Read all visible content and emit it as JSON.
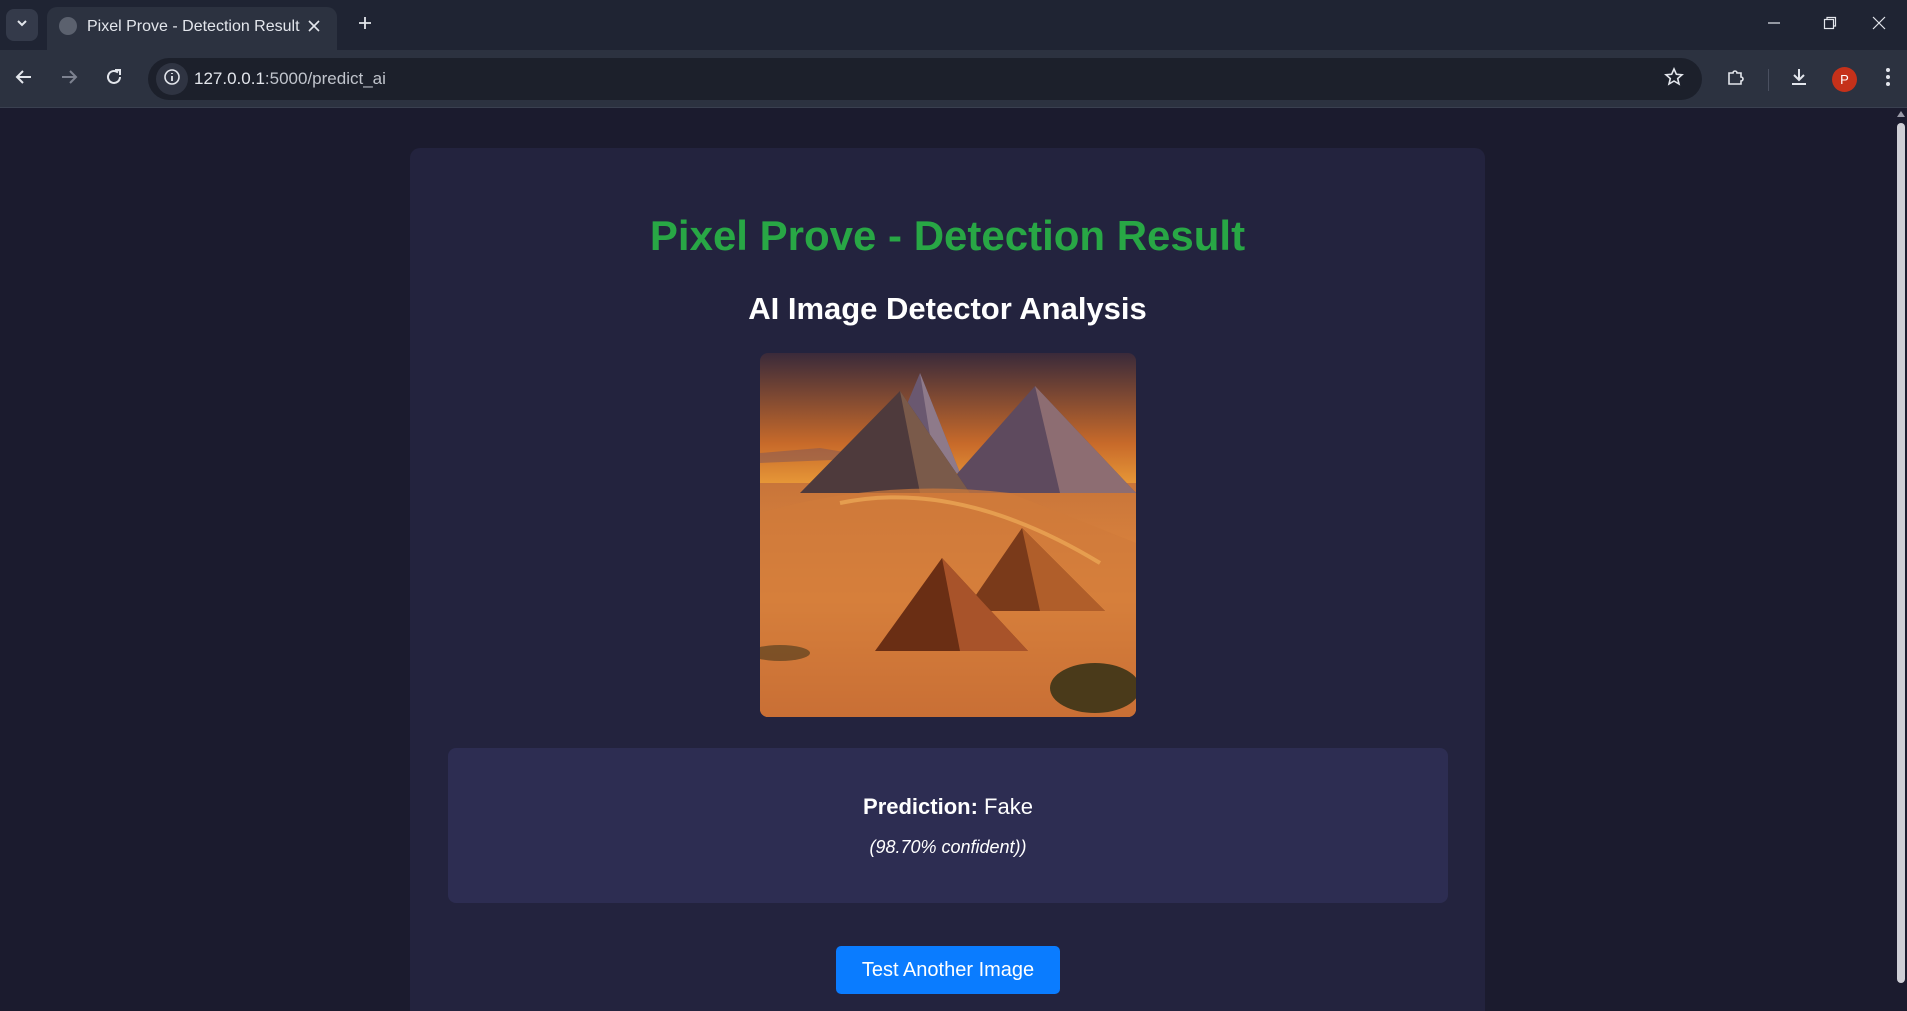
{
  "browser": {
    "tab_title": "Pixel Prove - Detection Result",
    "url_host": "127.0.0.1",
    "url_path": ":5000/predict_ai",
    "profile_initial": "P"
  },
  "page": {
    "title": "Pixel Prove - Detection Result",
    "subtitle": "AI Image Detector Analysis",
    "image_alt": "Pyramids in desert at sunset",
    "prediction_label": "Prediction:",
    "prediction_value": "Fake",
    "confidence_text": "(98.70% confident))",
    "button_label": "Test Another Image"
  },
  "colors": {
    "title": "#28a745",
    "button": "#0a7cff",
    "card_bg": "#23233e",
    "result_bg": "#2d2d52",
    "page_bg": "#1b1b2e"
  },
  "icons": [
    "tab-list-icon",
    "globe-favicon-icon",
    "close-tab-icon",
    "new-tab-icon",
    "minimize-icon",
    "restore-icon",
    "close-window-icon",
    "back-icon",
    "forward-icon",
    "reload-icon",
    "site-info-icon",
    "bookmark-star-icon",
    "extensions-icon",
    "download-icon",
    "menu-icon"
  ]
}
